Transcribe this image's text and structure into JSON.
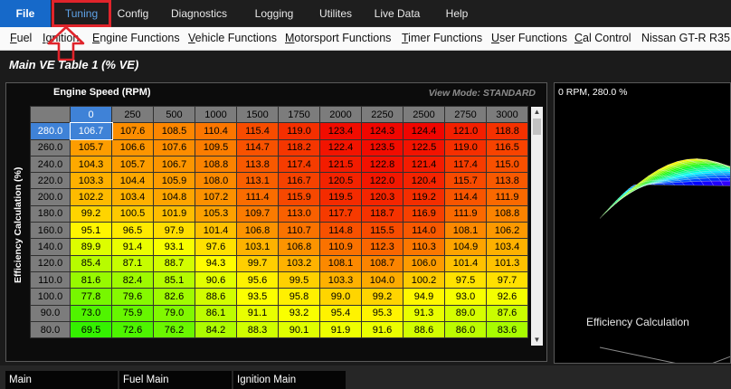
{
  "menubar": {
    "file": "File",
    "tuning": "Tuning",
    "config": "Config",
    "diagnostics": "Diagnostics",
    "logging": "Logging",
    "utilites": "Utilites",
    "live_data": "Live Data",
    "help": "Help"
  },
  "functions": [
    {
      "key": "F",
      "rest": "uel"
    },
    {
      "key": "I",
      "rest": "gnition"
    },
    {
      "key": "E",
      "rest": "ngine Functions"
    },
    {
      "key": "V",
      "rest": "ehicle Functions"
    },
    {
      "key": "M",
      "rest": "otorsport Functions"
    },
    {
      "key": "T",
      "rest": "imer Functions"
    },
    {
      "key": "U",
      "rest": "ser Functions"
    },
    {
      "key": "C",
      "rest": "al Control"
    },
    {
      "key": "",
      "rest": "Nissan GT-R R35"
    }
  ],
  "page_title": "Main VE Table 1 (% VE)",
  "table": {
    "x_axis_title": "Engine Speed (RPM)",
    "y_axis_title": "Efficiency Calculation (%)",
    "view_mode": "View Mode: STANDARD",
    "rpm": [
      "0",
      "250",
      "500",
      "1000",
      "1500",
      "1750",
      "2000",
      "2250",
      "2500",
      "2750",
      "3000"
    ],
    "efficiency": [
      "280.0",
      "260.0",
      "240.0",
      "220.0",
      "200.0",
      "180.0",
      "160.0",
      "140.0",
      "120.0",
      "110.0",
      "100.0",
      "90.0",
      "80.0"
    ],
    "values": [
      [
        "106.7",
        "107.6",
        "108.5",
        "110.4",
        "115.4",
        "119.0",
        "123.4",
        "124.3",
        "124.4",
        "121.0",
        "118.8"
      ],
      [
        "105.7",
        "106.6",
        "107.6",
        "109.5",
        "114.7",
        "118.2",
        "122.4",
        "123.5",
        "122.5",
        "119.0",
        "116.5"
      ],
      [
        "104.3",
        "105.7",
        "106.7",
        "108.8",
        "113.8",
        "117.4",
        "121.5",
        "122.8",
        "121.4",
        "117.4",
        "115.0"
      ],
      [
        "103.3",
        "104.4",
        "105.9",
        "108.0",
        "113.1",
        "116.7",
        "120.5",
        "122.0",
        "120.4",
        "115.7",
        "113.8"
      ],
      [
        "102.2",
        "103.4",
        "104.8",
        "107.2",
        "111.4",
        "115.9",
        "119.5",
        "120.3",
        "119.2",
        "114.4",
        "111.9"
      ],
      [
        "99.2",
        "100.5",
        "101.9",
        "105.3",
        "109.7",
        "113.0",
        "117.7",
        "118.7",
        "116.9",
        "111.9",
        "108.8"
      ],
      [
        "95.1",
        "96.5",
        "97.9",
        "101.4",
        "106.8",
        "110.7",
        "114.8",
        "115.5",
        "114.0",
        "108.1",
        "106.2"
      ],
      [
        "89.9",
        "91.4",
        "93.1",
        "97.6",
        "103.1",
        "106.8",
        "110.9",
        "112.3",
        "110.3",
        "104.9",
        "103.4"
      ],
      [
        "85.4",
        "87.1",
        "88.7",
        "94.3",
        "99.7",
        "103.2",
        "108.1",
        "108.7",
        "106.0",
        "101.4",
        "101.3"
      ],
      [
        "81.6",
        "82.4",
        "85.1",
        "90.6",
        "95.6",
        "99.5",
        "103.3",
        "104.0",
        "100.2",
        "97.5",
        "97.7"
      ],
      [
        "77.8",
        "79.6",
        "82.6",
        "88.6",
        "93.5",
        "95.8",
        "99.0",
        "99.2",
        "94.9",
        "93.0",
        "92.6"
      ],
      [
        "73.0",
        "75.9",
        "79.0",
        "86.1",
        "91.1",
        "93.2",
        "95.4",
        "95.3",
        "91.3",
        "89.0",
        "87.6"
      ],
      [
        "69.5",
        "72.6",
        "76.2",
        "84.2",
        "88.3",
        "90.1",
        "91.9",
        "91.6",
        "88.6",
        "86.0",
        "83.6"
      ]
    ],
    "selected": {
      "row": 0,
      "col": 0
    }
  },
  "graph": {
    "status": "0 RPM, 280.0 %",
    "axis_label": "Efficiency Calculation"
  },
  "bottom_tabs": [
    "Main",
    "Fuel Main",
    "Ignition Main"
  ],
  "colors": {
    "file_menu_bg": "#1669c9",
    "highlight_box": "#e0242b",
    "selection": "#3f82d7"
  }
}
